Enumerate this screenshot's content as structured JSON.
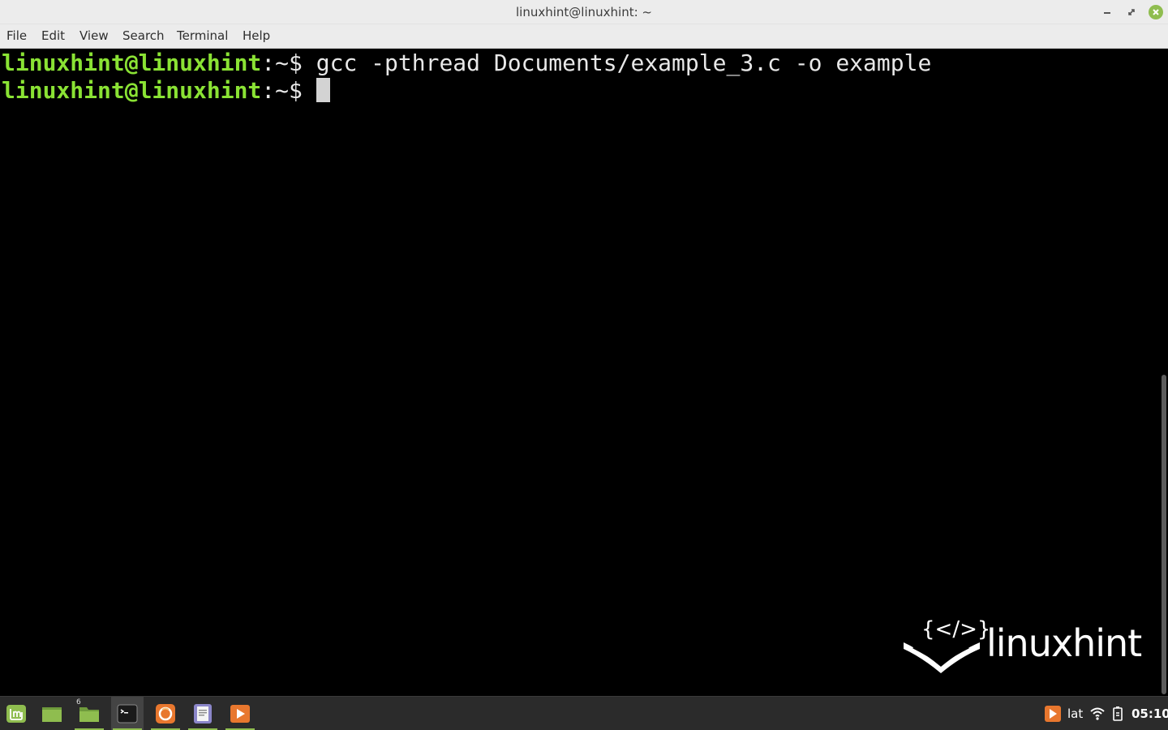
{
  "window": {
    "title": "linuxhint@linuxhint: ~"
  },
  "menu": [
    "File",
    "Edit",
    "View",
    "Search",
    "Terminal",
    "Help"
  ],
  "terminal": {
    "lines": [
      {
        "user_host": "linuxhint@linuxhint",
        "sep": ":",
        "path": "~$ ",
        "command": "gcc -pthread Documents/example_3.c -o example"
      },
      {
        "user_host": "linuxhint@linuxhint",
        "sep": ":",
        "path": "~$ ",
        "command": ""
      }
    ]
  },
  "watermark": {
    "text": "linuxhint",
    "emblem": "{</>}"
  },
  "taskbar": {
    "apps": [
      {
        "name": "mint-menu-icon",
        "active": false
      },
      {
        "name": "show-desktop-icon",
        "active": false
      },
      {
        "name": "files-icon",
        "badge": "6",
        "active": false
      },
      {
        "name": "terminal-icon",
        "active": true
      },
      {
        "name": "firefox-icon",
        "active": false
      },
      {
        "name": "text-editor-icon",
        "active": false
      },
      {
        "name": "media-player-icon",
        "active": false
      }
    ],
    "tray": {
      "keyboard_layout": "lat",
      "clock": "05:10"
    }
  },
  "colors": {
    "prompt_user": "#8ae234",
    "accent": "#8fbd4f",
    "terminal_bg": "#000000",
    "taskbar_bg": "#2b2b2b"
  }
}
